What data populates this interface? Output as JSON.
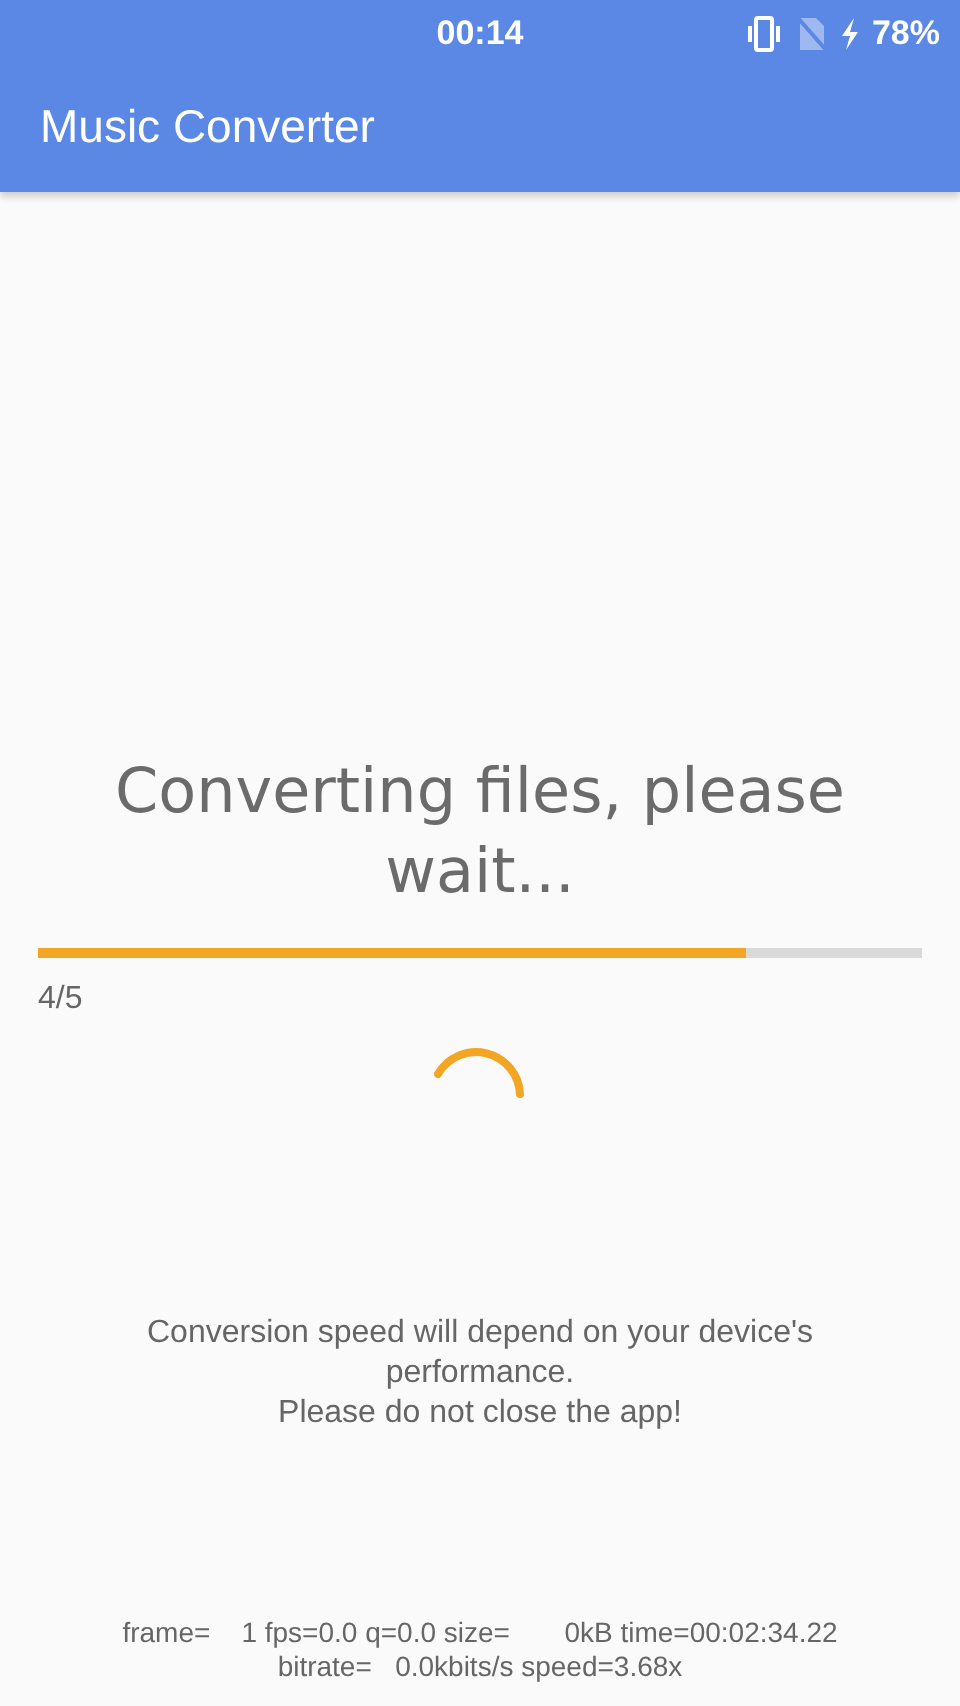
{
  "status_bar": {
    "time": "00:14",
    "battery": "78%"
  },
  "toolbar": {
    "title": "Music Converter"
  },
  "progress": {
    "heading": "Converting files, please wait...",
    "level": 0.8,
    "count": "4/5"
  },
  "notice": [
    "Conversion speed will depend on your device's performance.",
    "Please do not close the app!"
  ],
  "log": [
    "frame=    1 fps=0.0 q=0.0 size=       0kB time=00:02:34.22",
    "bitrate=   0.0kbits/s speed=3.68x"
  ]
}
